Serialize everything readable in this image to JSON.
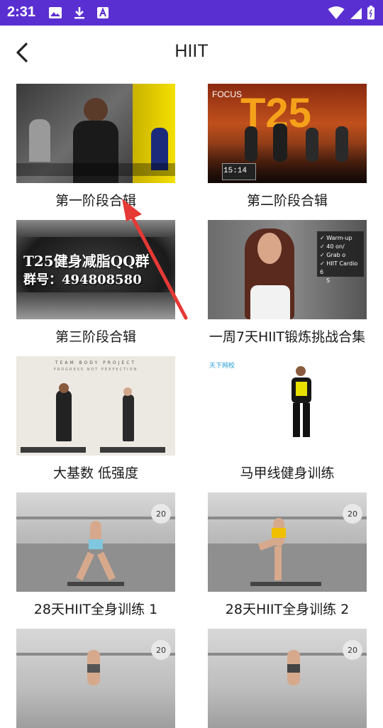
{
  "status_bar": {
    "time": "2:31"
  },
  "header": {
    "title": "HIIT"
  },
  "videos": [
    {
      "caption": "第一阶段合辑"
    },
    {
      "caption": "第二阶段合辑"
    },
    {
      "caption": "第三阶段合辑",
      "overlay_line1": "T25健身减脂QQ群",
      "overlay_line2": "群号：494808580"
    },
    {
      "caption": "一周7天HIIT锻炼挑战合集",
      "checklist": [
        "Warm-up",
        "40 on/",
        "Grab o",
        "HIIT Cardio 6",
        "S"
      ]
    },
    {
      "caption": "大基数 低强度",
      "banner": "TEAM BODY PROJECT",
      "sub_banner": "PROGRESS NOT PERFECTION"
    },
    {
      "caption": "马甲线健身训练",
      "logo_text": "天下网校"
    },
    {
      "caption": "28天HIIT全身训练 1",
      "badge": "20"
    },
    {
      "caption": "28天HIIT全身训练 2",
      "badge": "20"
    },
    {
      "caption": "",
      "badge": "20"
    },
    {
      "caption": "",
      "badge": "20"
    }
  ],
  "thumb_texts": {
    "focus_logo": "FOCUS",
    "t25_logo": "T25",
    "timer": "15:14"
  },
  "colors": {
    "status_bar": "#5a2fd1",
    "annotation_arrow": "#e53935"
  }
}
